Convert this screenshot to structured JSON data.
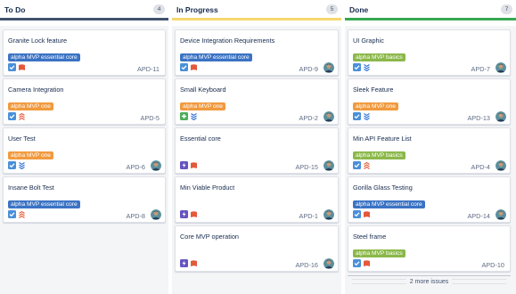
{
  "columns": [
    {
      "title": "To Do",
      "count": "4",
      "bar_color": "#42526e",
      "cards": [
        {
          "title": "Granite Lock feature",
          "epic": "alpha MVP essential core",
          "epic_color": "#3b73c4",
          "key": "APD-11",
          "type": "story",
          "priority": "medium",
          "avatar": false
        },
        {
          "title": "Camera Integration",
          "epic": "alpha MVP one",
          "epic_color": "#f19a3e",
          "key": "APD-5",
          "type": "story",
          "priority": "highest",
          "avatar": false
        },
        {
          "title": "User Test",
          "epic": "alpha MVP one",
          "epic_color": "#f19a3e",
          "key": "APD-6",
          "type": "story",
          "priority": "lowest",
          "avatar": true
        },
        {
          "title": "Insane Bolt Test",
          "epic": "alpha MVP essential core",
          "epic_color": "#3b73c4",
          "key": "APD-8",
          "type": "story",
          "priority": "highest",
          "avatar": true
        }
      ]
    },
    {
      "title": "In Progress",
      "count": "5",
      "bar_color": "#f5d76e",
      "cards": [
        {
          "title": "Device Integration Requirements",
          "epic": "alpha MVP essential core",
          "epic_color": "#3b73c4",
          "key": "APD-9",
          "type": "story",
          "priority": "medium",
          "avatar": true
        },
        {
          "title": "Small Keyboard",
          "epic": "alpha MVP one",
          "epic_color": "#f19a3e",
          "key": "APD-2",
          "type": "improvement",
          "priority": "lowest",
          "avatar": true
        },
        {
          "title": "Essential core",
          "epic": "",
          "epic_color": "",
          "key": "APD-15",
          "type": "epic",
          "priority": "medium",
          "avatar": true
        },
        {
          "title": "Min Viable Product",
          "epic": "",
          "epic_color": "",
          "key": "APD-1",
          "type": "epic",
          "priority": "medium",
          "avatar": true
        },
        {
          "title": "Core MVP operation",
          "epic": "",
          "epic_color": "",
          "key": "APD-16",
          "type": "epic",
          "priority": "medium",
          "avatar": true
        }
      ]
    },
    {
      "title": "Done",
      "count": "7",
      "bar_color": "#36a852",
      "cards": [
        {
          "title": "UI Graphic",
          "epic": "alpha MVP basics",
          "epic_color": "#8bb84a",
          "key": "APD-7",
          "type": "story",
          "priority": "lowest",
          "avatar": true
        },
        {
          "title": "Sleek Feature",
          "epic": "alpha MVP one",
          "epic_color": "#f19a3e",
          "key": "APD-13",
          "type": "story",
          "priority": "lowest",
          "avatar": true
        },
        {
          "title": "Min API Feature List",
          "epic": "alpha MVP basics",
          "epic_color": "#8bb84a",
          "key": "APD-4",
          "type": "story",
          "priority": "highest",
          "avatar": true
        },
        {
          "title": "Gorilla Glass Testing",
          "epic": "alpha MVP essential core",
          "epic_color": "#3b73c4",
          "key": "APD-14",
          "type": "story",
          "priority": "medium",
          "avatar": true
        },
        {
          "title": "Steel frame",
          "epic": "alpha MVP basics",
          "epic_color": "#8bb84a",
          "key": "APD-10",
          "type": "story",
          "priority": "medium",
          "avatar": false
        }
      ],
      "more_label": "2 more issues"
    }
  ],
  "colors": {
    "story": "#4a90d9",
    "improvement": "#4fad5b",
    "epic": "#6554c0",
    "priority_medium": "#e5593b",
    "priority_highest": "#e5593b",
    "priority_lowest": "#2f6fd6"
  }
}
